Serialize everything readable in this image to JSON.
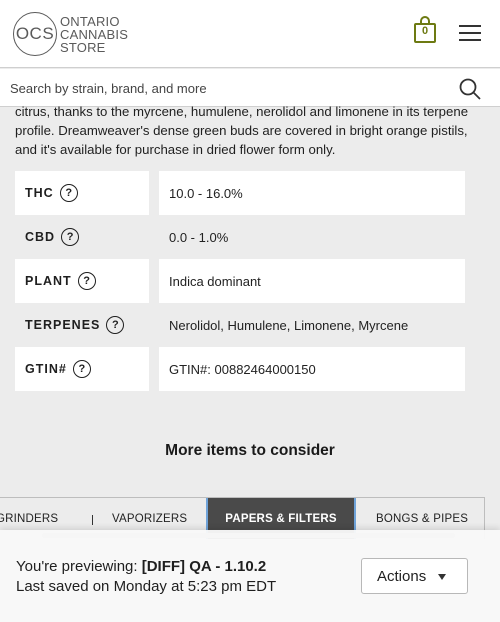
{
  "header": {
    "logo": {
      "abbr": "OCS",
      "line1": "ONTARIO",
      "line2": "CANNABIS",
      "line3": "STORE"
    },
    "cart_count": "0",
    "cart_icon": "shopping-bag-icon",
    "menu_icon": "hamburger-menu-icon"
  },
  "search": {
    "placeholder": "Search by strain, brand, and more",
    "icon": "search-icon"
  },
  "description": "citrus, thanks to the myrcene, humulene, nerolidol and limonene in its terpene profile. Dreamweaver's dense green buds are covered in bright orange pistils, and it's available for purchase in dried flower form only.",
  "attributes": [
    {
      "label": "THC",
      "value": "10.0 - 16.0%"
    },
    {
      "label": "CBD",
      "value": "0.0 - 1.0%"
    },
    {
      "label": "PLANT",
      "value": "Indica dominant"
    },
    {
      "label": "TERPENES",
      "value": "Nerolidol, Humulene, Limonene, Myrcene"
    },
    {
      "label": "GTIN#",
      "value": "GTIN#: 00882464000150"
    }
  ],
  "help_glyph": "?",
  "more_items": {
    "title": "More items to consider",
    "tabs": [
      "GRINDERS",
      "VAPORIZERS",
      "PAPERS & FILTERS",
      "BONGS & PIPES"
    ],
    "active_tab": "PAPERS & FILTERS"
  },
  "preview": {
    "prefix": "You're previewing: ",
    "name": "[DIFF] QA - 1.10.2",
    "saved": "Last saved on Monday at 5:23 pm EDT",
    "actions_label": "Actions"
  },
  "colors": {
    "accent_cart": "#6d7a12",
    "active_tab_bg": "#4a4a4a",
    "active_tab_border": "#6fa3d9",
    "page_bg": "#ececec"
  }
}
